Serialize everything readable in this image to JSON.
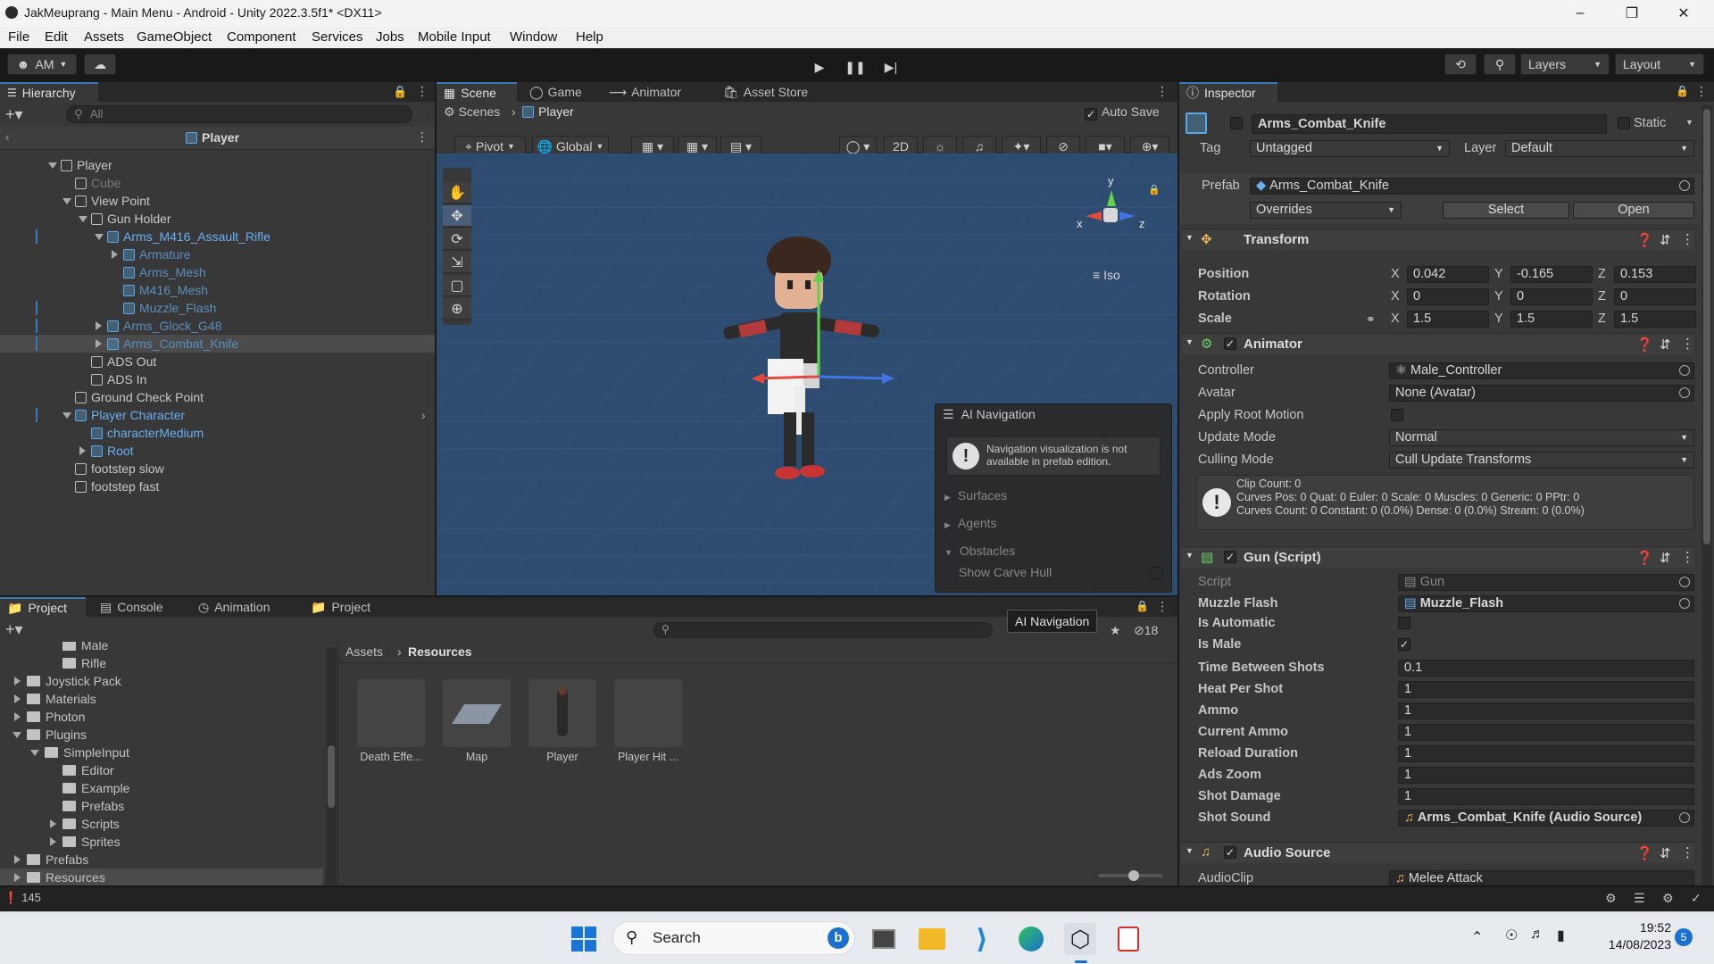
{
  "window": {
    "title": "JakMeuprang - Main Menu - Android - Unity 2022.3.5f1* <DX11>"
  },
  "menu": [
    "File",
    "Edit",
    "Assets",
    "GameObject",
    "Component",
    "Services",
    "Jobs",
    "Mobile Input",
    "Window",
    "Help"
  ],
  "toolbar": {
    "account": "AM",
    "layers": "Layers",
    "layout": "Layout"
  },
  "hierarchy": {
    "tab": "Hierarchy",
    "search_placeholder": "All",
    "breadcrumb": "Player",
    "items": [
      {
        "label": "Player",
        "style": "normal"
      },
      {
        "label": "Cube",
        "style": "dim"
      },
      {
        "label": "View Point",
        "style": "normal"
      },
      {
        "label": "Gun Holder",
        "style": "normal"
      },
      {
        "label": "Arms_M416_Assault_Rifle",
        "style": "prefab"
      },
      {
        "label": "Armature",
        "style": "prefab-dim"
      },
      {
        "label": "Arms_Mesh",
        "style": "prefab-dim"
      },
      {
        "label": "M416_Mesh",
        "style": "prefab-dim"
      },
      {
        "label": "Muzzle_Flash",
        "style": "prefab-dim"
      },
      {
        "label": "Arms_Glock_G48",
        "style": "prefab-dim"
      },
      {
        "label": "Arms_Combat_Knife",
        "style": "prefab-dim"
      },
      {
        "label": "ADS Out",
        "style": "normal"
      },
      {
        "label": "ADS In",
        "style": "normal"
      },
      {
        "label": "Ground Check Point",
        "style": "normal"
      },
      {
        "label": "Player Character",
        "style": "prefab"
      },
      {
        "label": "characterMedium",
        "style": "prefab"
      },
      {
        "label": "Root",
        "style": "prefab"
      },
      {
        "label": "footstep slow",
        "style": "normal"
      },
      {
        "label": "footstep fast",
        "style": "normal"
      }
    ]
  },
  "scene": {
    "tabs": [
      "Scene",
      "Game",
      "Animator",
      "Asset Store"
    ],
    "breadcrumb_scenes": "Scenes",
    "breadcrumb_player": "Player",
    "autosave": "Auto Save",
    "pivot": "Pivot",
    "global": "Global",
    "mode2d": "2D",
    "iso": "Iso",
    "gizmo_x": "x",
    "gizmo_y": "y",
    "gizmo_z": "z",
    "ai_nav": {
      "title": "AI Navigation",
      "warning": "Navigation visualization is not available in prefab edition.",
      "items": [
        "Surfaces",
        "Agents",
        "Obstacles",
        "Show Carve Hull"
      ]
    }
  },
  "bottom": {
    "tabs": [
      "Project",
      "Console",
      "Animation",
      "Project"
    ],
    "tooltip": "AI Navigation",
    "hidden_count": "18",
    "breadcrumb_assets": "Assets",
    "breadcrumb_res": "Resources",
    "tree": [
      {
        "label": "Male",
        "indent": 3
      },
      {
        "label": "Rifle",
        "indent": 3
      },
      {
        "label": "Joystick Pack",
        "indent": 1
      },
      {
        "label": "Materials",
        "indent": 1
      },
      {
        "label": "Photon",
        "indent": 1
      },
      {
        "label": "Plugins",
        "indent": 1
      },
      {
        "label": "SimpleInput",
        "indent": 2
      },
      {
        "label": "Editor",
        "indent": 3
      },
      {
        "label": "Example",
        "indent": 3
      },
      {
        "label": "Prefabs",
        "indent": 3
      },
      {
        "label": "Scripts",
        "indent": 3
      },
      {
        "label": "Sprites",
        "indent": 3
      },
      {
        "label": "Prefabs",
        "indent": 1
      },
      {
        "label": "Resources",
        "indent": 1
      }
    ],
    "assets": [
      "Death Effe...",
      "Map",
      "Player",
      "Player Hit ..."
    ]
  },
  "inspector": {
    "tab": "Inspector",
    "name": "Arms_Combat_Knife",
    "static": "Static",
    "tag_label": "Tag",
    "tag": "Untagged",
    "layer_label": "Layer",
    "layer": "Default",
    "prefab_label": "Prefab",
    "prefab": "Arms_Combat_Knife",
    "overrides": "Overrides",
    "select": "Select",
    "open": "Open",
    "transform": {
      "title": "Transform",
      "position_label": "Position",
      "rotation_label": "Rotation",
      "scale_label": "Scale",
      "x": "X",
      "y": "Y",
      "z": "Z",
      "position": [
        "0.042",
        "-0.165",
        "0.153"
      ],
      "rotation": [
        "0",
        "0",
        "0"
      ],
      "scale": [
        "1.5",
        "1.5",
        "1.5"
      ]
    },
    "animator": {
      "title": "Animator",
      "controller_label": "Controller",
      "controller": "Male_Controller",
      "avatar_label": "Avatar",
      "avatar": "None (Avatar)",
      "root_motion_label": "Apply Root Motion",
      "update_label": "Update Mode",
      "update": "Normal",
      "culling_label": "Culling Mode",
      "culling": "Cull Update Transforms",
      "info1": "Clip Count: 0",
      "info2": "Curves Pos: 0 Quat: 0 Euler: 0 Scale: 0 Muscles: 0 Generic: 0 PPtr: 0",
      "info3": "Curves Count: 0 Constant: 0 (0.0%) Dense: 0 (0.0%) Stream: 0 (0.0%)"
    },
    "gun": {
      "title": "Gun (Script)",
      "fields": [
        {
          "label": "Script",
          "value": "Gun"
        },
        {
          "label": "Muzzle Flash",
          "value": "Muzzle_Flash"
        },
        {
          "label": "Is Automatic",
          "value": ""
        },
        {
          "label": "Is Male",
          "value": "✓"
        },
        {
          "label": "Time Between Shots",
          "value": "0.1"
        },
        {
          "label": "Heat Per Shot",
          "value": "1"
        },
        {
          "label": "Ammo",
          "value": "1"
        },
        {
          "label": "Current Ammo",
          "value": "1"
        },
        {
          "label": "Reload Duration",
          "value": "1"
        },
        {
          "label": "Ads Zoom",
          "value": "1"
        },
        {
          "label": "Shot Damage",
          "value": "1"
        },
        {
          "label": "Shot Sound",
          "value": "Arms_Combat_Knife (Audio Source)"
        }
      ]
    },
    "audio": {
      "title": "Audio Source",
      "clip_label": "AudioClip",
      "clip": "Melee Attack"
    }
  },
  "status": {
    "count": "145"
  },
  "taskbar": {
    "search": "Search",
    "time": "19:52",
    "date": "14/08/2023",
    "badge": "5"
  }
}
